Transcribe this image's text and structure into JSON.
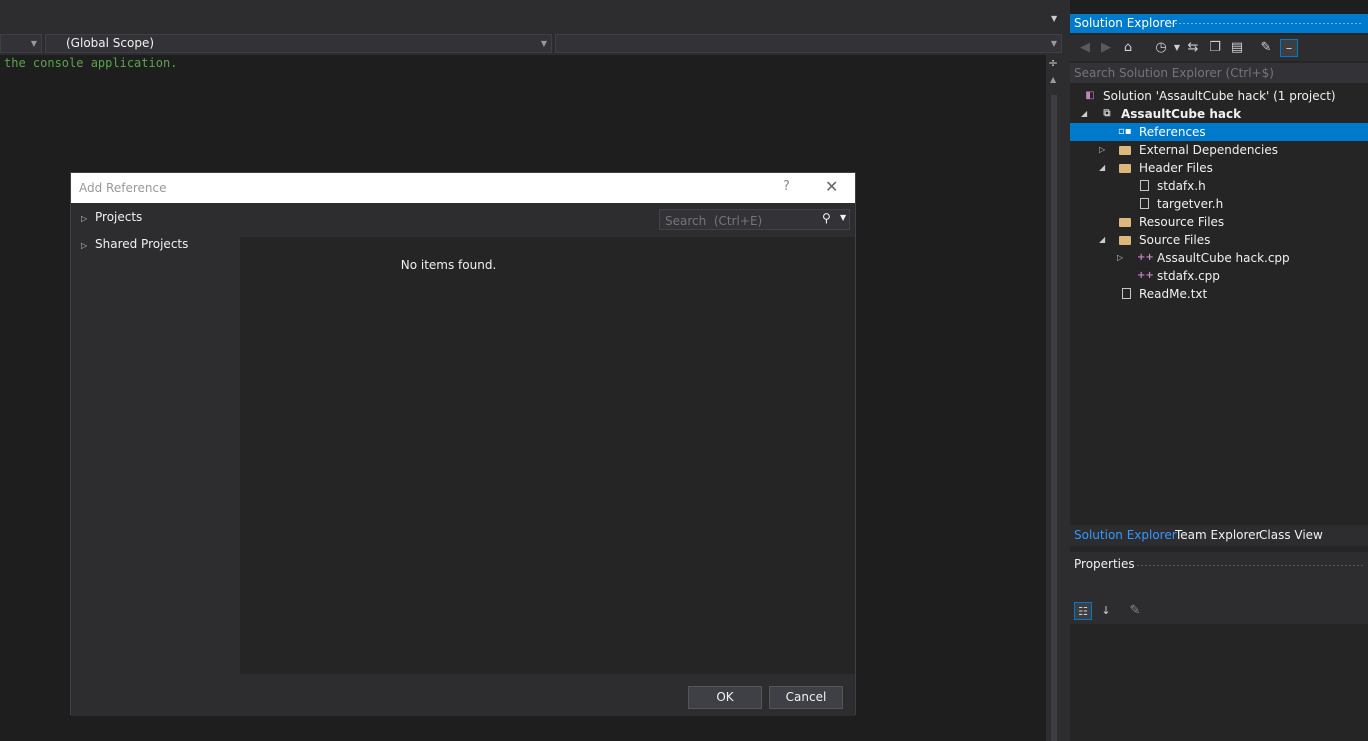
{
  "editor": {
    "nav_combo_left": "",
    "nav_combo_scope": "(Global Scope)",
    "nav_combo_right": "",
    "code_line": "the console application."
  },
  "dialog": {
    "title": "Add Reference",
    "help_glyph": "?",
    "close_glyph": "✕",
    "tree": [
      {
        "label": "Projects"
      },
      {
        "label": "Shared Projects"
      }
    ],
    "search_placeholder": "Search  (Ctrl+E)",
    "empty_text": "No items found.",
    "ok_label": "OK",
    "cancel_label": "Cancel"
  },
  "solution_explorer": {
    "title": "Solution Explorer",
    "search_placeholder": "Search Solution Explorer (Ctrl+$)",
    "nodes": [
      {
        "label": "Solution 'AssaultCube hack' (1 project)"
      },
      {
        "label": "AssaultCube hack"
      },
      {
        "label": "References"
      },
      {
        "label": "External Dependencies"
      },
      {
        "label": "Header Files"
      },
      {
        "label": "stdafx.h"
      },
      {
        "label": "targetver.h"
      },
      {
        "label": "Resource Files"
      },
      {
        "label": "Source Files"
      },
      {
        "label": "AssaultCube hack.cpp"
      },
      {
        "label": "stdafx.cpp"
      },
      {
        "label": "ReadMe.txt"
      }
    ],
    "tabs": [
      "Solution Explorer",
      "Team Explorer",
      "Class View"
    ]
  },
  "properties": {
    "title": "Properties"
  },
  "colors": {
    "accent": "#007acc",
    "editor_bg": "#1e1e1e",
    "panel_bg": "#252526",
    "comment_green": "#57a64a"
  }
}
